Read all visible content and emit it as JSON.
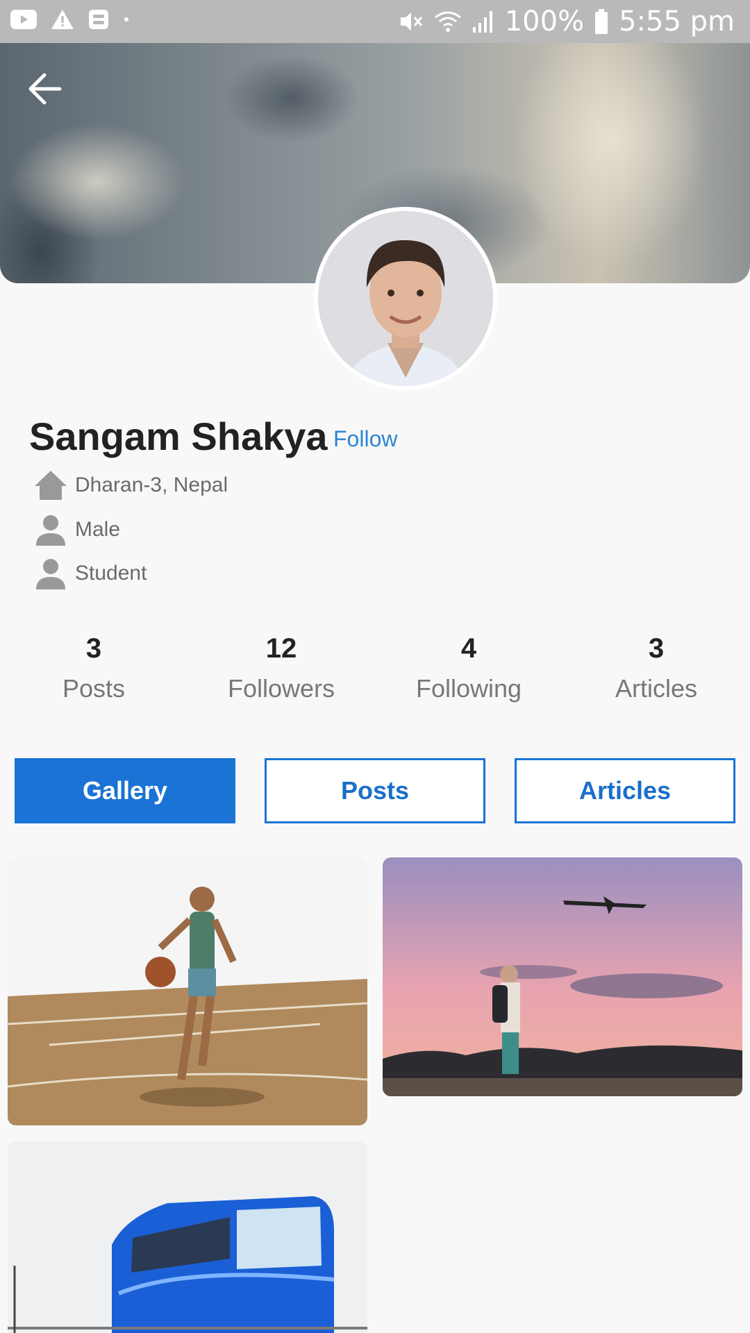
{
  "status_bar": {
    "left_icons": [
      "youtube-icon",
      "warning-icon",
      "sim-icon",
      "dot-icon"
    ],
    "battery": "100%",
    "time": "5:55 pm"
  },
  "profile": {
    "name": "Sangam Shakya",
    "follow_label": "Follow",
    "location": "Dharan-3, Nepal",
    "gender": "Male",
    "occupation": "Student"
  },
  "stats": [
    {
      "count": "3",
      "label": "Posts"
    },
    {
      "count": "12",
      "label": "Followers"
    },
    {
      "count": "4",
      "label": "Following"
    },
    {
      "count": "3",
      "label": "Articles"
    }
  ],
  "tabs": [
    {
      "label": "Gallery",
      "active": true
    },
    {
      "label": "Posts",
      "active": false
    },
    {
      "label": "Articles",
      "active": false
    }
  ],
  "gallery": [
    "basketball-player",
    "traveler-airplane-sunset",
    "blue-tourist-bus"
  ],
  "colors": {
    "accent": "#1a73d5",
    "follow": "#2b85d6",
    "status_bar": "#b9b9b9"
  }
}
